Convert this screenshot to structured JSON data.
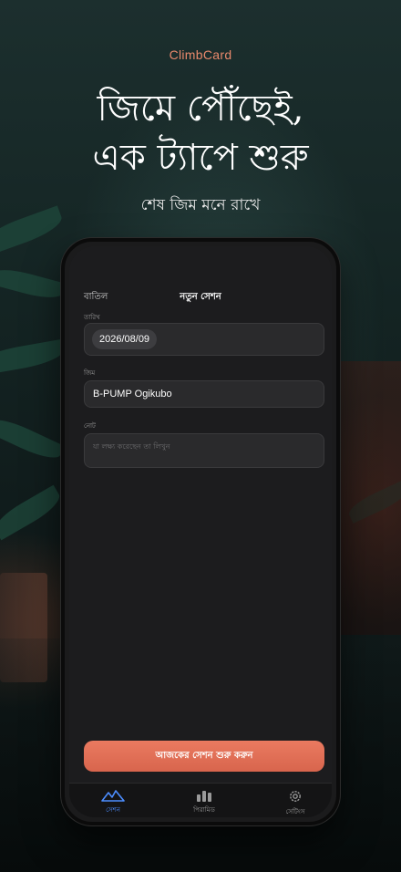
{
  "promo": {
    "brand": "ClimbCard",
    "headline_line1": "জিমে পৌঁছেই,",
    "headline_line2": "এক ট্যাপে শুরু",
    "subheadline": "শেষ জিম মনে রাখে"
  },
  "screen": {
    "nav": {
      "cancel_label": "বাতিল",
      "title": "নতুন সেশন"
    },
    "form": {
      "date_label": "তারিখ",
      "date_value": "2026/08/09",
      "gym_label": "জিম",
      "gym_value": "B-PUMP Ogikubo",
      "note_label": "নোট",
      "note_placeholder": "যা লক্ষ্য করেছেন তা লিখুন"
    },
    "cta_label": "আজকের সেশন শুরু করুন",
    "tabs": [
      {
        "label": "সেশন",
        "icon": "mountain-icon",
        "active": true
      },
      {
        "label": "পিরামিড",
        "icon": "bar-chart-icon",
        "active": false
      },
      {
        "label": "সেটিংস",
        "icon": "gear-icon",
        "active": false
      }
    ]
  },
  "colors": {
    "accent": "#e9896c",
    "cta": "#e0705a",
    "active_tab": "#4c8dff",
    "inactive_tab": "#9a9a9a"
  }
}
